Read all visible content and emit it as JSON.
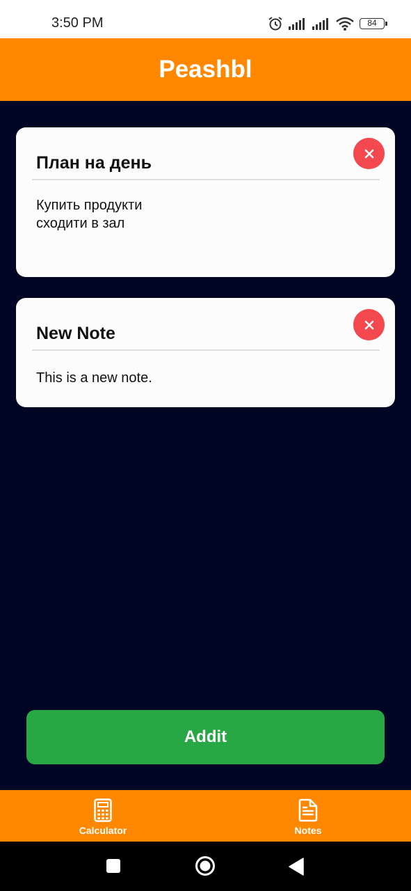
{
  "status_bar": {
    "time": "3:50 PM",
    "battery": "84"
  },
  "app": {
    "title": "Peashbl"
  },
  "notes": [
    {
      "title": "План на день",
      "body": "Купить продукти\nсходити в зал"
    },
    {
      "title": "New Note",
      "body": "This is a new note."
    }
  ],
  "add_button": {
    "label": "Addit"
  },
  "tabs": [
    {
      "label": "Calculator",
      "icon": "calculator-icon"
    },
    {
      "label": "Notes",
      "icon": "document-icon"
    }
  ],
  "colors": {
    "accent": "#ff8800",
    "background": "#000624",
    "add_button": "#28a745",
    "delete_button": "#f4484f"
  }
}
